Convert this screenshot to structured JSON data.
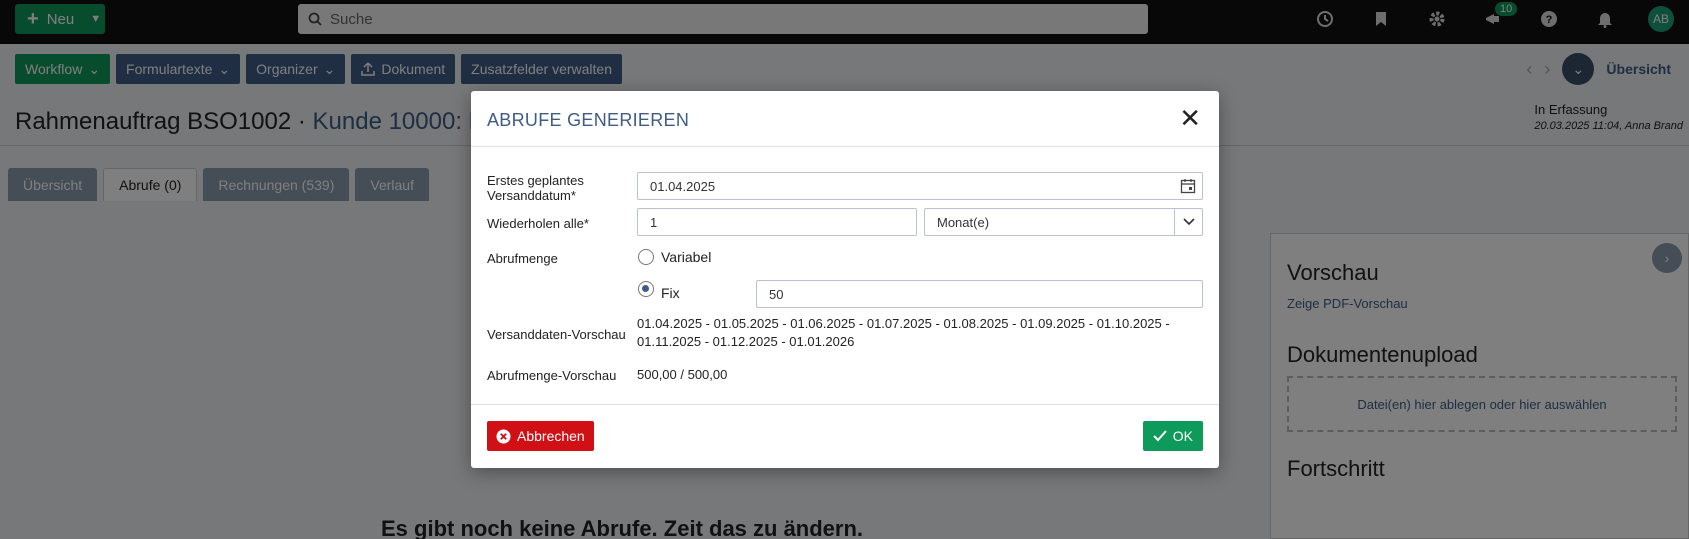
{
  "topbar": {
    "new_label": "Neu",
    "search_placeholder": "Suche",
    "notification_count": "10",
    "avatar_initials": "AB"
  },
  "toolbar": {
    "workflow": "Workflow",
    "formulartexte": "Formulartexte",
    "organizer": "Organizer",
    "dokument": "Dokument",
    "zusatzfelder": "Zusatzfelder verwalten",
    "uebersicht_link": "Übersicht"
  },
  "header": {
    "title": "Rahmenauftrag BSO1002 · ",
    "customer": "Kunde 10000: B",
    "status": "In Erfassung",
    "status_meta": "20.03.2025 11:04, Anna Brand"
  },
  "tabs": [
    "Übersicht",
    "Abrufe (0)",
    "Rechnungen (539)",
    "Verlauf"
  ],
  "sidebar": {
    "preview_title": "Vorschau",
    "preview_link": "Zeige PDF-Vorschau",
    "upload_title": "Dokumentenupload",
    "dropzone_text": "Datei(en) hier ablegen oder hier auswählen",
    "progress_title": "Fortschritt"
  },
  "main": {
    "empty_text": "Es gibt noch keine Abrufe. Zeit das zu ändern."
  },
  "modal": {
    "title": "ABRUFE GENERIEREN",
    "first_date_label_1": "Erstes geplantes",
    "first_date_label_2": "Versanddatum*",
    "first_date_value": "01.04.2025",
    "repeat_label": "Wiederholen alle*",
    "repeat_value": "1",
    "repeat_unit": "Monat(e)",
    "quantity_label": "Abrufmenge",
    "option_variable": "Variabel",
    "option_fix": "Fix",
    "fix_value": "50",
    "dates_preview_label": "Versanddaten-Vorschau",
    "dates_preview_line1": "01.04.2025 - 01.05.2025 - 01.06.2025 - 01.07.2025 - 01.08.2025 - 01.09.2025 - 01.10.2025 -",
    "dates_preview_line2": "01.11.2025 - 01.12.2025 - 01.01.2026",
    "quantity_preview_label": "Abrufmenge-Vorschau",
    "quantity_preview_value": "500,00 / 500,00",
    "cancel_label": "Abbrechen",
    "ok_label": "OK"
  },
  "colors": {
    "brand_green": "#0e9a5a",
    "nav_blue": "#3e5c86",
    "danger_red": "#d11016"
  }
}
